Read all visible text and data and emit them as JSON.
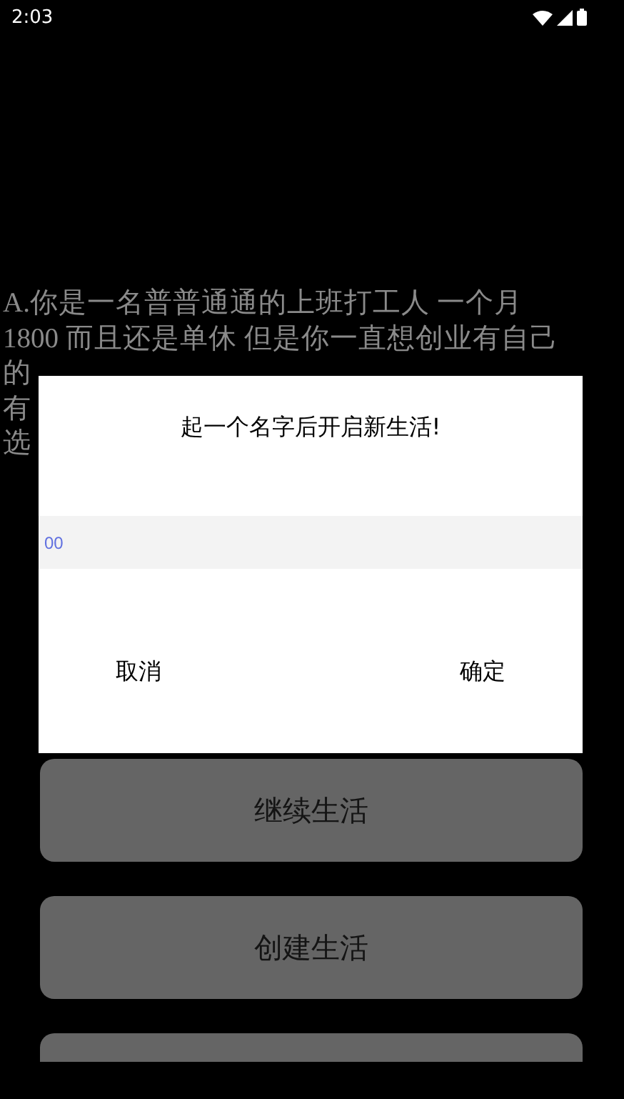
{
  "status_bar": {
    "time": "2:03"
  },
  "story": {
    "lines": [
      "A.你是一名普普通通的上班打工人 一个月",
      "1800 而且还是单休 但是你一直想创业有自己",
      "的"
    ],
    "line_4_start": "有",
    "line_5_start": "选"
  },
  "menu_buttons": [
    {
      "kind": "labeled",
      "label": "继续生活"
    },
    {
      "kind": "labeled",
      "label": "创建生活"
    },
    {
      "kind": "blank"
    }
  ],
  "dialog": {
    "title": "起一个名字后开启新生活!",
    "name_field": {
      "value": "00"
    },
    "buttons": [
      {
        "label": "取消"
      },
      {
        "label": "确定"
      }
    ]
  }
}
